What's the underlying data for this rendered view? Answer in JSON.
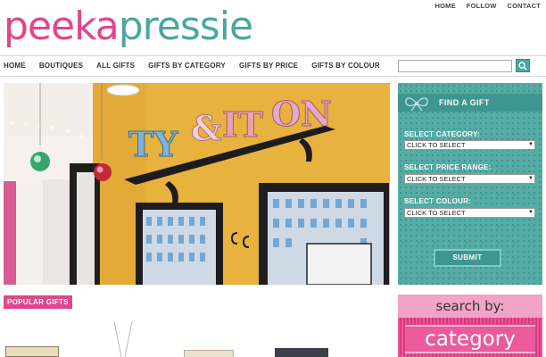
{
  "logo": {
    "part1": "peeka",
    "part2": "pressie"
  },
  "topnav": [
    "HOME",
    "FOLLOW",
    "CONTACT"
  ],
  "mainnav": [
    "HOME",
    "BOUTIQUES",
    "ALL GIFTS",
    "GIFTS BY CATEGORY",
    "GIFTS BY PRICE",
    "GIFTS BY COLOUR"
  ],
  "search": {
    "value": "",
    "button_icon": "search-icon"
  },
  "finder": {
    "title": "FIND A GIFT",
    "category_label": "SELECT CATEGORY:",
    "category_value": "CLICK TO SELECT",
    "price_label": "SELECT PRICE RANGE:",
    "price_value": "CLICK TO SELECT",
    "colour_label": "SELECT COLOUR:",
    "colour_value": "CLICK TO SELECT",
    "submit": "SUBMIT"
  },
  "popular": {
    "label": "POPULAR GIFTS"
  },
  "searchby": {
    "top": "search by:",
    "bottom": "category"
  },
  "colors": {
    "pink": "#e0468b",
    "teal": "#4aa6a0",
    "mustard": "#e9b540"
  }
}
